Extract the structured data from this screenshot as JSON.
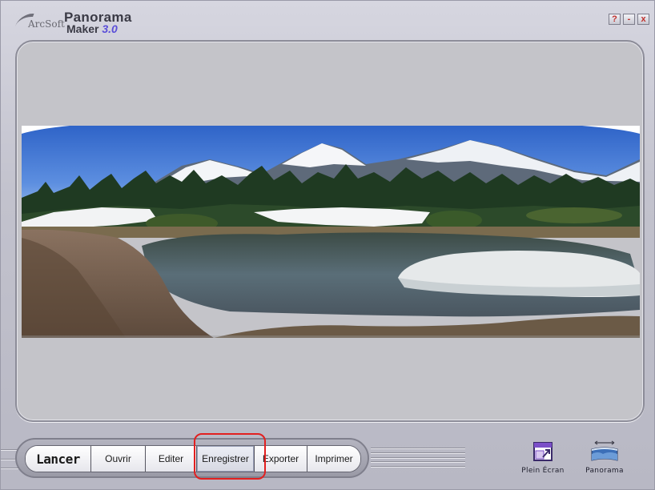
{
  "app": {
    "logo_brand": "ArcSoft",
    "logo_line1": "Panorama",
    "logo_line2": "Maker",
    "logo_version": "3.0"
  },
  "window_controls": {
    "help": "?",
    "minimize": "-",
    "close": "x"
  },
  "toolbar": {
    "buttons": [
      {
        "label": "Lancer"
      },
      {
        "label": "Ouvrir"
      },
      {
        "label": "Editer"
      },
      {
        "label": "Enregistrer"
      },
      {
        "label": "Exporter"
      },
      {
        "label": "Imprimer"
      }
    ]
  },
  "right_tools": {
    "fullscreen_label": "Plein Écran",
    "panorama_label": "Panorama"
  },
  "icons": {
    "fullscreen": "fullscreen-icon",
    "panorama": "panorama-icon",
    "help": "help-icon",
    "minimize": "minimize-icon",
    "close": "close-icon"
  },
  "colors": {
    "window_bg": "#c6c6d0",
    "preview_bg": "#c4c4c9",
    "highlight": "#e22020",
    "version_accent": "#5b4fd8"
  }
}
